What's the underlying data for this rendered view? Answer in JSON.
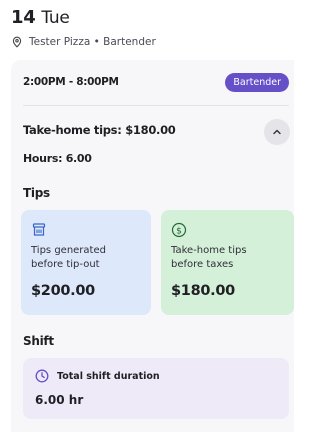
{
  "header": {
    "day_number": "14",
    "day_of_week": "Tue",
    "location": "Tester Pizza • Bartender"
  },
  "shift_card": {
    "time_range": "2:00PM - 8:00PM",
    "role_badge": "Bartender",
    "take_home_line": "Take-home tips: $180.00",
    "hours_line": "Hours: 6.00"
  },
  "tips_section": {
    "title": "Tips",
    "generated": {
      "label": "Tips generated before tip-out",
      "amount": "$200.00",
      "icon": "tip-jar-icon"
    },
    "take_home": {
      "label": "Take-home tips before taxes",
      "amount": "$180.00",
      "icon": "dollar-circle-icon"
    }
  },
  "shift_section": {
    "title": "Shift",
    "duration_label": "Total shift duration",
    "duration_value": "6.00 hr",
    "icon": "clock-icon"
  },
  "colors": {
    "accent": "#6650c8",
    "tips_generated_bg": "#dde8fa",
    "take_home_bg": "#d5f0d8",
    "shift_bg": "#eeeaf8"
  }
}
